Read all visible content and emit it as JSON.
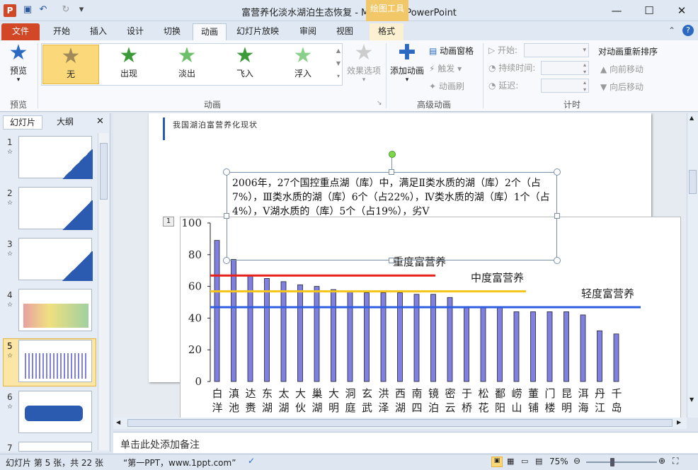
{
  "title": "富营养化淡水湖泊生态恢复 - Microsoft PowerPoint",
  "contextual_tab": "绘图工具",
  "tabs": [
    "文件",
    "开始",
    "插入",
    "设计",
    "切换",
    "动画",
    "幻灯片放映",
    "审阅",
    "视图",
    "格式"
  ],
  "ribbon": {
    "preview": "预览",
    "preview_group": "预览",
    "effects": [
      "无",
      "出现",
      "淡出",
      "飞入",
      "浮入"
    ],
    "effect_options": "效果选项",
    "animation_group": "动画",
    "add_animation": "添加动画",
    "anim_pane": "动画窗格",
    "trigger": "触发",
    "anim_painter": "动画刷",
    "advanced_group": "高级动画",
    "start": "开始:",
    "duration": "持续时间:",
    "delay": "延迟:",
    "timing_group": "计时",
    "reorder": "对动画重新排序",
    "move_earlier": "向前移动",
    "move_later": "向后移动"
  },
  "panel": {
    "tab_slides": "幻灯片",
    "tab_outline": "大纲"
  },
  "slides": [
    {
      "n": "1"
    },
    {
      "n": "2"
    },
    {
      "n": "3"
    },
    {
      "n": "4"
    },
    {
      "n": "5"
    },
    {
      "n": "6"
    },
    {
      "n": "7"
    }
  ],
  "slide": {
    "header": "我国湖泊富营养化现状",
    "text": "2006年，27个国控重点湖（库）中，满足Ⅱ类水质的湖（库）2个（占7%），Ⅲ类水质的湖（库）6个（占22%），Ⅳ类水质的湖（库）1个（占4%），Ⅴ湖水质的（库）5个（占19%），劣Ⅴ",
    "anim_tag": "1"
  },
  "notes": "单击此处添加备注",
  "status": {
    "slide_info": "幻灯片 第 5 张，共 22 张",
    "theme": "“第一PPT，www.1ppt.com”",
    "zoom": "75%"
  },
  "colors": {
    "red": "#e8201a",
    "yellow": "#f5c518",
    "blue": "#2f5fe0",
    "bar": "#8080e0"
  },
  "chart_data": {
    "type": "bar",
    "ylim": [
      0,
      100
    ],
    "yticks": [
      0,
      20,
      40,
      60,
      80,
      100
    ],
    "categories": [
      "白洋",
      "滇池",
      "达赉",
      "东湖",
      "太湖",
      "大伙",
      "巢湖",
      "大明",
      "洞庭",
      "玄武",
      "洪泽",
      "西湖",
      "南四",
      "镜泊",
      "密云",
      "于桥",
      "松花",
      "鄱阳",
      "崂山",
      "董铺",
      "门楼",
      "昆明",
      "洱海",
      "丹江",
      "千岛"
    ],
    "values": [
      89,
      77,
      67,
      65,
      63,
      61,
      60,
      58,
      57,
      56,
      56,
      56,
      55,
      55,
      53,
      47,
      47,
      47,
      44,
      44,
      44,
      44,
      42,
      32,
      30
    ],
    "thresholds": [
      {
        "name": "重度富营养",
        "value": 70,
        "color": "#e8201a"
      },
      {
        "name": "中度富营养",
        "value": 60,
        "color": "#f5c518"
      },
      {
        "name": "轻度富营养",
        "value": 50,
        "color": "#2f5fe0"
      }
    ]
  }
}
